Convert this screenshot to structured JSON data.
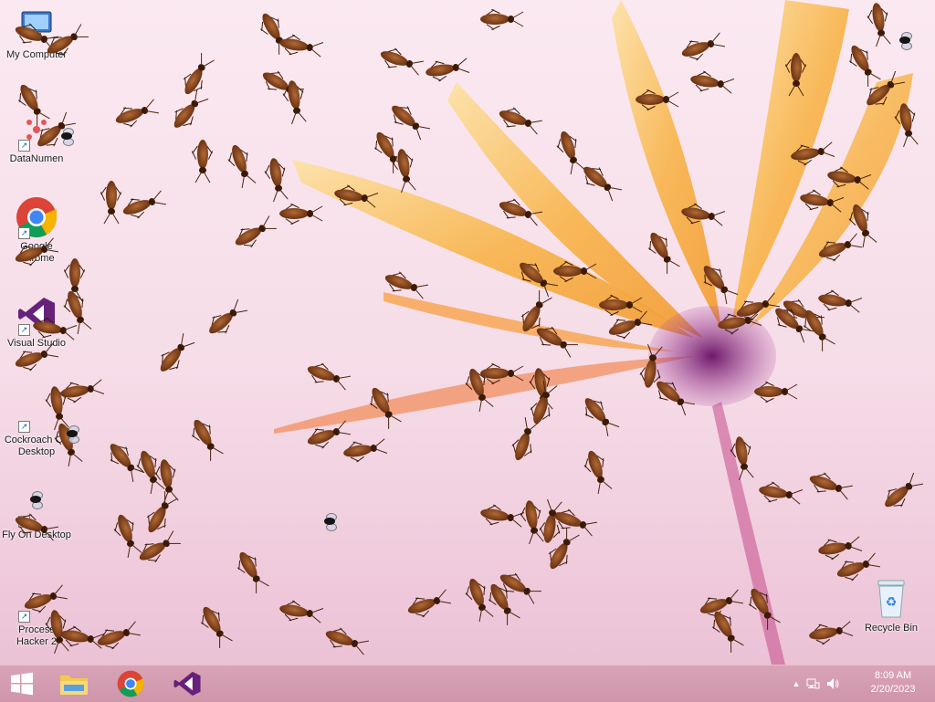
{
  "desktop": {
    "icons": [
      {
        "label": "My Computer"
      },
      {
        "label": "DataNumen"
      },
      {
        "label": "Google Chrome"
      },
      {
        "label": "Visual Studio"
      },
      {
        "label": "Cockroach On Desktop"
      },
      {
        "label": "Fly On Desktop"
      },
      {
        "label": "Process Hacker 2"
      }
    ],
    "recycle_bin": {
      "label": "Recycle Bin"
    }
  },
  "taskbar": {
    "start": "windows-logo-icon",
    "pinned": [
      "file-explorer-icon",
      "chrome-icon",
      "visual-studio-icon"
    ],
    "tray": {
      "show_hidden": "▲",
      "network": "network-icon",
      "volume": "volume-icon"
    },
    "clock": {
      "time": "8:09 AM",
      "date": "2/20/2023"
    }
  },
  "colors": {
    "taskbar": "#d3a0b3",
    "wallpaper": "#f7e1eb",
    "petal": "#f8b44a",
    "flower_center": "#8a2a7d"
  }
}
